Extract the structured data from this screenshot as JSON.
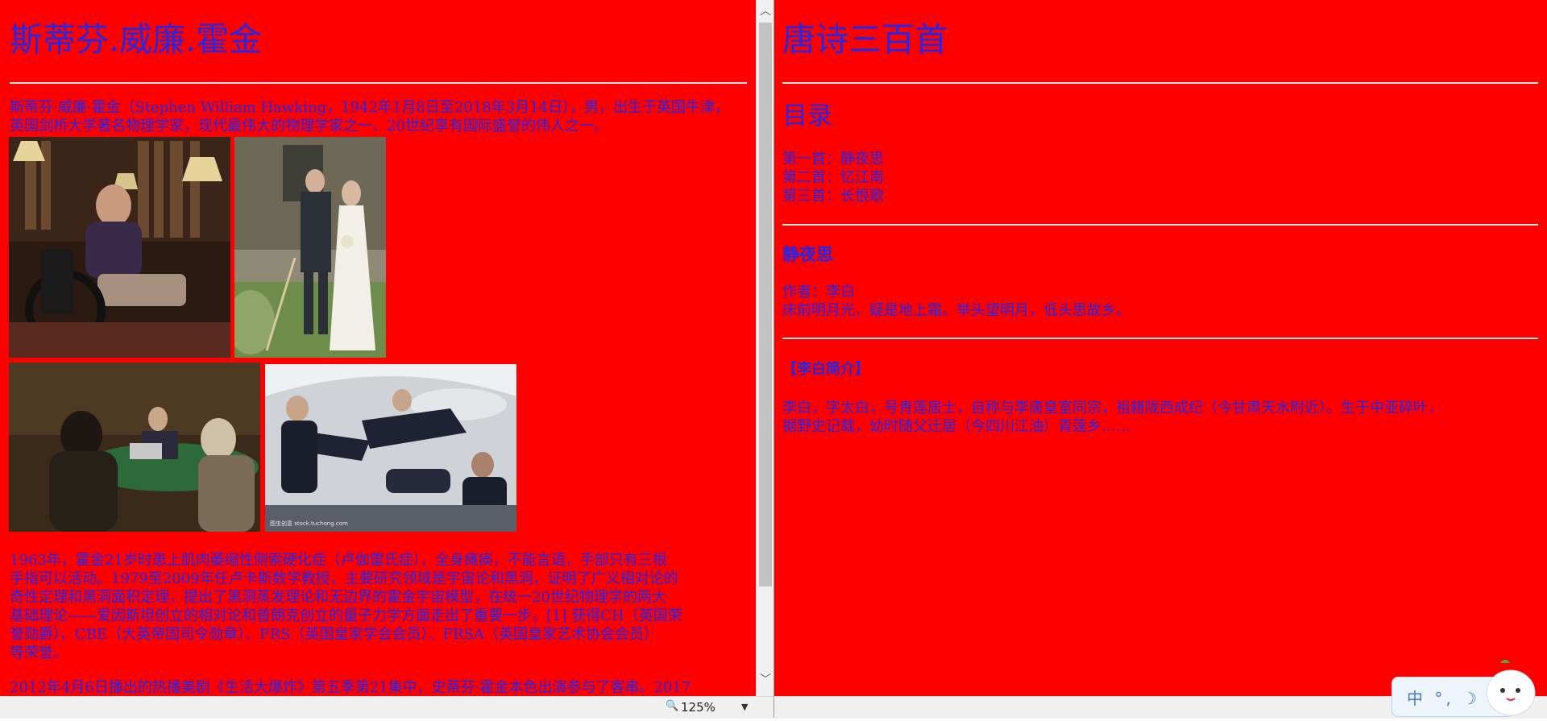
{
  "left": {
    "title": "斯蒂芬.威廉.霍金",
    "intro_line1": "斯蒂芬·威廉·霍金（Stephen William Hawking，1942年1月8日至2018年3月14日），男，出生于英国牛津，",
    "intro_line2": "英国剑桥大学著名物理学家，现代最伟大的物理学家之一、20世纪享有国际盛誉的伟人之一。",
    "body_lines": [
      "1963年，霍金21岁时患上肌肉萎缩性侧索硬化症（卢伽雷氏症），全身瘫痪，不能言语，手部只有三根",
      "手指可以活动。1979至2009年任卢卡斯数学教授，主要研究领域是宇宙论和黑洞，证明了广义相对论的",
      "奇性定理和黑洞面积定理，提出了黑洞蒸发理论和无边界的霍金宇宙模型，在统一20世纪物理学的两大",
      "基础理论——爱因斯坦创立的相对论和普朗克创立的量子力学方面走出了重要一步。[1] 获得CH（英国荣",
      "誉勋爵）、CBE（大英帝国司令勋章）、FRS（英国皇家学会会员）、FRSA（英国皇家艺术协会会员）",
      "等荣誉。"
    ],
    "last_line": "2012年4月6日播出的热播美剧《生活大爆炸》第五季第21集中，史蒂芬·霍金本色出演参与了客串。2017",
    "photo_watermark": "图虫创意 stock.tuchong.com"
  },
  "right": {
    "title": "唐诗三百首",
    "toc_heading": "目录",
    "toc": [
      "第一首：静夜思",
      "第二首：忆江南",
      "第三首：长恨歌"
    ],
    "poem_title": "静夜思",
    "poem_author": "作者：李白",
    "poem_text": "床前明月光，疑是地上霜。举头望明月，低头思故乡。",
    "bio_heading": "【李白简介】",
    "bio_line1": "李白，字太白，号青莲居士，自称与李唐皇室同宗，祖籍陇西成纪（今甘肃天水附近）。生于中亚碎叶，",
    "bio_line2": "据野史记载，幼时随父迁居（今四川江油）青莲乡……"
  },
  "status": {
    "zoom": "125%"
  },
  "ime": {
    "label": "中 °, ☽ 👕"
  },
  "colors": {
    "page_bg": "#ff0000",
    "text": "#2626e6",
    "rule": "#e6e6e6"
  }
}
